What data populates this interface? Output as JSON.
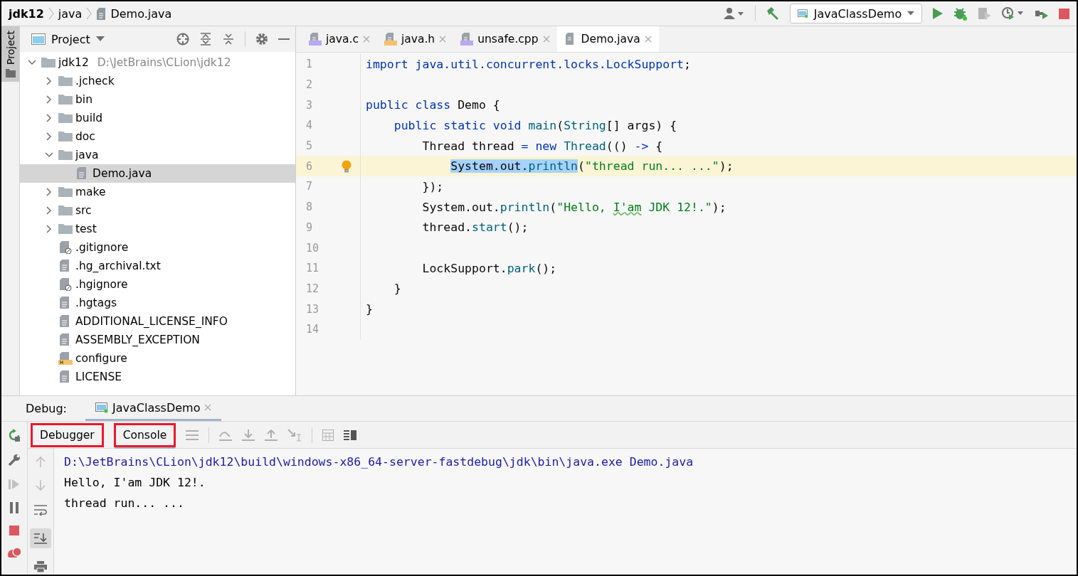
{
  "breadcrumbs": [
    {
      "label": "jdk12",
      "kind": "project"
    },
    {
      "label": "java",
      "kind": "folder"
    },
    {
      "label": "Demo.java",
      "kind": "file"
    }
  ],
  "run_config": {
    "name": "JavaClassDemo"
  },
  "tool_strip": {
    "label": "Project"
  },
  "project_panel": {
    "title": "Project",
    "tree": [
      {
        "label": "jdk12",
        "path": "D:\\JetBrains\\CLion\\jdk12",
        "kind": "folder",
        "expanded": true,
        "selected": false,
        "children": [
          {
            "label": ".jcheck",
            "kind": "folder",
            "expanded": false,
            "selected": false
          },
          {
            "label": "bin",
            "kind": "folder",
            "expanded": false,
            "selected": false
          },
          {
            "label": "build",
            "kind": "folder",
            "expanded": false,
            "selected": false
          },
          {
            "label": "doc",
            "kind": "folder",
            "expanded": false,
            "selected": false
          },
          {
            "label": "java",
            "kind": "folder",
            "expanded": true,
            "selected": false,
            "children": [
              {
                "label": "Demo.java",
                "kind": "text",
                "selected": true
              }
            ]
          },
          {
            "label": "make",
            "kind": "folder",
            "expanded": false,
            "selected": false
          },
          {
            "label": "src",
            "kind": "folder",
            "expanded": false,
            "selected": false
          },
          {
            "label": "test",
            "kind": "folder",
            "expanded": false,
            "selected": false
          },
          {
            "label": ".gitignore",
            "kind": "ignore",
            "selected": false
          },
          {
            "label": ".hg_archival.txt",
            "kind": "text",
            "selected": false
          },
          {
            "label": ".hgignore",
            "kind": "ignore",
            "selected": false
          },
          {
            "label": ".hgtags",
            "kind": "text",
            "selected": false
          },
          {
            "label": "ADDITIONAL_LICENSE_INFO",
            "kind": "text",
            "selected": false
          },
          {
            "label": "ASSEMBLY_EXCEPTION",
            "kind": "text",
            "selected": false
          },
          {
            "label": "configure",
            "kind": "header",
            "selected": false
          },
          {
            "label": "LICENSE",
            "kind": "text",
            "selected": false
          }
        ]
      }
    ]
  },
  "editor_tabs": [
    {
      "label": "java.c",
      "kind": "c",
      "selected": false
    },
    {
      "label": "java.h",
      "kind": "h",
      "selected": false
    },
    {
      "label": "unsafe.cpp",
      "kind": "cpp",
      "selected": false
    },
    {
      "label": "Demo.java",
      "kind": "java",
      "selected": true
    }
  ],
  "code_lines": [
    {
      "number": "1",
      "tokens": [
        {
          "text": "import ",
          "kind": "kw"
        },
        {
          "text": "java.util.concurrent.locks.LockSupport",
          "kind": "pkg"
        },
        {
          "text": ";",
          "kind": "plain"
        }
      ]
    },
    {
      "number": "2"
    },
    {
      "number": "3",
      "tokens": [
        {
          "text": "public class ",
          "kind": "kw"
        },
        {
          "text": "Demo {",
          "kind": "plain"
        }
      ]
    },
    {
      "number": "4",
      "tokens": [
        {
          "text": "    public static void ",
          "kind": "kw"
        },
        {
          "text": "main",
          "kind": "method"
        },
        {
          "text": "(",
          "kind": "plain"
        },
        {
          "text": "String",
          "kind": "type"
        },
        {
          "text": "[] args) {",
          "kind": "plain"
        }
      ]
    },
    {
      "number": "5",
      "tokens": [
        {
          "text": "        Thread thread ",
          "kind": "plain"
        },
        {
          "text": "= new ",
          "kind": "kw"
        },
        {
          "text": "Thread",
          "kind": "type"
        },
        {
          "text": "(() ",
          "kind": "plain"
        },
        {
          "text": "->",
          "kind": "kw"
        },
        {
          "text": " {",
          "kind": "plain"
        }
      ]
    },
    {
      "number": "6",
      "current": true,
      "intention": true,
      "tokens": [
        {
          "text": "            System.out.",
          "kind": "plain",
          "highlight": true
        },
        {
          "text": "println",
          "kind": "method",
          "highlight": true
        },
        {
          "text": "(",
          "kind": "plain"
        },
        {
          "text": "\"thread run... ...\"",
          "kind": "string"
        },
        {
          "text": ");",
          "kind": "plain"
        }
      ]
    },
    {
      "number": "7",
      "tokens": [
        {
          "text": "        });",
          "kind": "plain"
        }
      ]
    },
    {
      "number": "8",
      "tokens": [
        {
          "text": "        System.out.",
          "kind": "plain"
        },
        {
          "text": "println",
          "kind": "method"
        },
        {
          "text": "(",
          "kind": "plain"
        },
        {
          "text": "\"Hello, ",
          "kind": "string"
        },
        {
          "text": "I'am",
          "kind": "string",
          "typo": true
        },
        {
          "text": " JDK 12!.\"",
          "kind": "string"
        },
        {
          "text": ");",
          "kind": "plain"
        }
      ]
    },
    {
      "number": "9",
      "tokens": [
        {
          "text": "        thread.",
          "kind": "plain"
        },
        {
          "text": "start",
          "kind": "method"
        },
        {
          "text": "();",
          "kind": "plain"
        }
      ]
    },
    {
      "number": "10"
    },
    {
      "number": "11",
      "tokens": [
        {
          "text": "        LockSupport.",
          "kind": "plain"
        },
        {
          "text": "park",
          "kind": "method"
        },
        {
          "text": "();",
          "kind": "plain"
        }
      ]
    },
    {
      "number": "12",
      "tokens": [
        {
          "text": "    }",
          "kind": "plain"
        }
      ]
    },
    {
      "number": "13",
      "tokens": [
        {
          "text": "}",
          "kind": "plain"
        }
      ]
    },
    {
      "number": "14"
    }
  ],
  "debug_panel": {
    "label": "Debug:",
    "session": "JavaClassDemo",
    "tabs": [
      {
        "label": "Debugger",
        "selected": false,
        "outlined": true
      },
      {
        "label": "Console",
        "selected": true,
        "outlined": true
      }
    ],
    "console": [
      {
        "text": "D:\\JetBrains\\CLion\\jdk12\\build\\windows-x86_64-server-fastdebug\\jdk\\bin\\java.exe Demo.java",
        "kind": "command"
      },
      {
        "text": "Hello, I'am JDK 12!.",
        "kind": "output"
      },
      {
        "text": "thread run... ...",
        "kind": "output"
      }
    ]
  }
}
